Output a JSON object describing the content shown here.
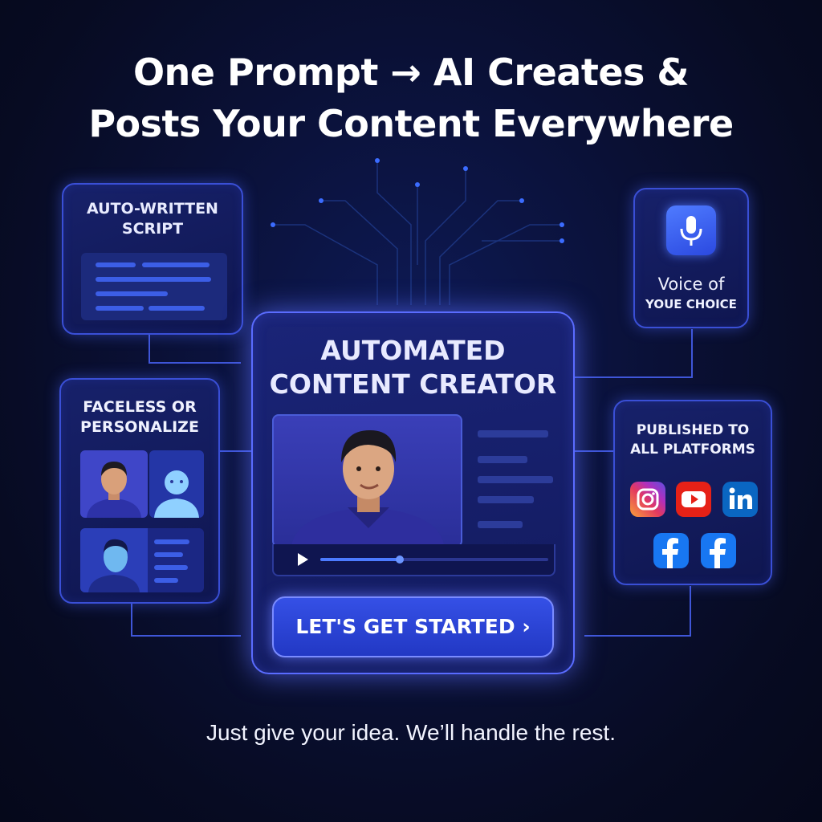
{
  "headline": {
    "line1": "One Prompt → AI Creates &",
    "line2": "Posts Your Content Everywhere"
  },
  "script_card": {
    "title_line1": "AUTO-WRITTEN",
    "title_line2": "SCRIPT"
  },
  "voice_card": {
    "title_line1": "Voice of",
    "title_line2": "YOUE CHOICE",
    "icon": "microphone-icon"
  },
  "faceless_card": {
    "title_line1": "FACELESS OR",
    "title_line2": "PERSONALIZE"
  },
  "main_card": {
    "title_line1": "AUTOMATED",
    "title_line2": "CONTENT CREATOR",
    "video_progress": 0.35,
    "cta_label": "LET'S GET STARTED ›"
  },
  "platforms_card": {
    "title_line1": "PUBLISHED TO",
    "title_line2": "ALL PLATFORMS",
    "icons": [
      "instagram-icon",
      "youtube-icon",
      "linkedin-icon",
      "facebook-icon",
      "facebook-icon"
    ]
  },
  "tagline": "Just give your idea. We’ll handle the rest.",
  "colors": {
    "background": "#070b22",
    "card_border": "#3a4fd6",
    "accent_blue": "#3c5ee6",
    "cta": "#2a44d6",
    "youtube_red": "#e62117",
    "linkedin_blue": "#0a66c2",
    "facebook_blue": "#1877f2"
  }
}
